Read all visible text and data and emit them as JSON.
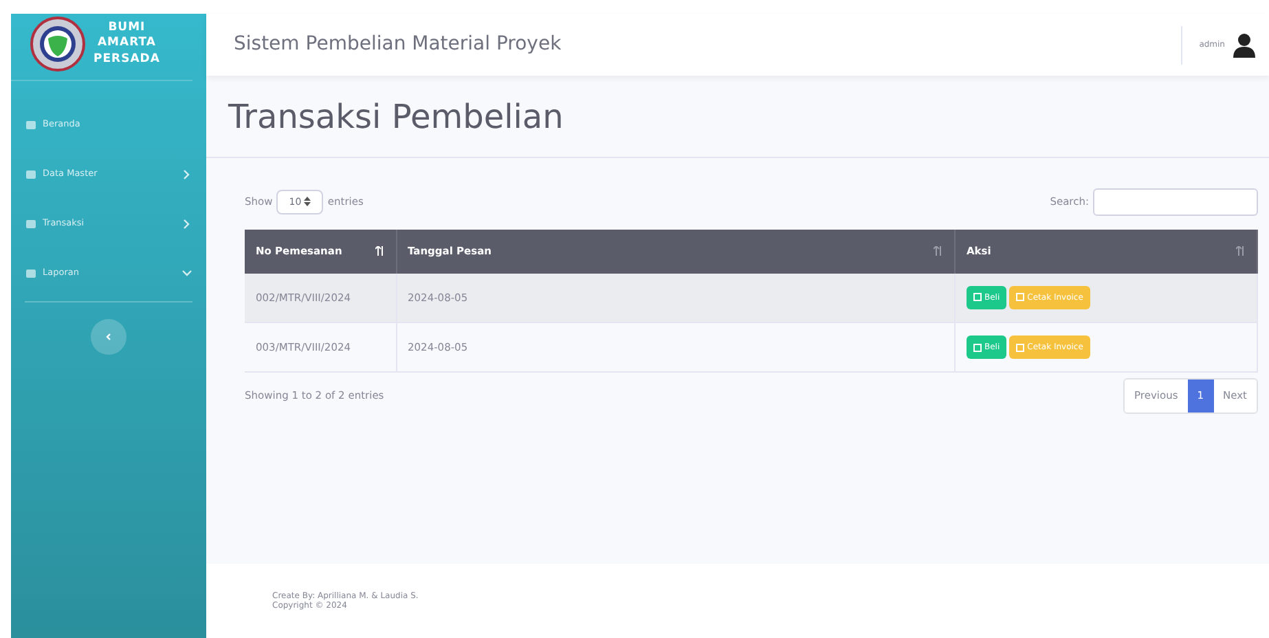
{
  "sidebar": {
    "brand": [
      "BUMI",
      "AMARTA",
      "PERSADA"
    ],
    "items": [
      {
        "label": "Beranda",
        "kind": "link"
      },
      {
        "label": "Data Master",
        "kind": "menu",
        "expanded": false
      },
      {
        "label": "Transaksi",
        "kind": "menu",
        "expanded": false
      },
      {
        "label": "Laporan",
        "kind": "menu",
        "expanded": true
      }
    ]
  },
  "topbar": {
    "title": "Sistem Pembelian Material Proyek",
    "user": "admin"
  },
  "page_title": "Transaksi Pembelian",
  "table_controls": {
    "show_label": "Show",
    "length": "10",
    "entries_label": "entries",
    "search_label": "Search:"
  },
  "table": {
    "columns": [
      {
        "label": "No Pemesanan",
        "sorted": true
      },
      {
        "label": "Tanggal Pesan",
        "sorted": false
      },
      {
        "label": "Aksi",
        "sorted": false
      }
    ],
    "rows": [
      {
        "no": "002/MTR/VIII/2024",
        "date": "2024-08-05",
        "actions": [
          "Beli",
          "Cetak Invoice"
        ]
      },
      {
        "no": "003/MTR/VIII/2024",
        "date": "2024-08-05",
        "actions": [
          "Beli",
          "Cetak Invoice"
        ]
      }
    ]
  },
  "info": "Showing 1 to 2 of 2 entries",
  "pagination": [
    {
      "label": "Previous",
      "selected": false
    },
    {
      "label": "1",
      "selected": true
    },
    {
      "label": "Next",
      "selected": false
    }
  ],
  "footer": [
    "Create By: Aprilliana M. & Laudia S.",
    "Copyright © 2024"
  ]
}
